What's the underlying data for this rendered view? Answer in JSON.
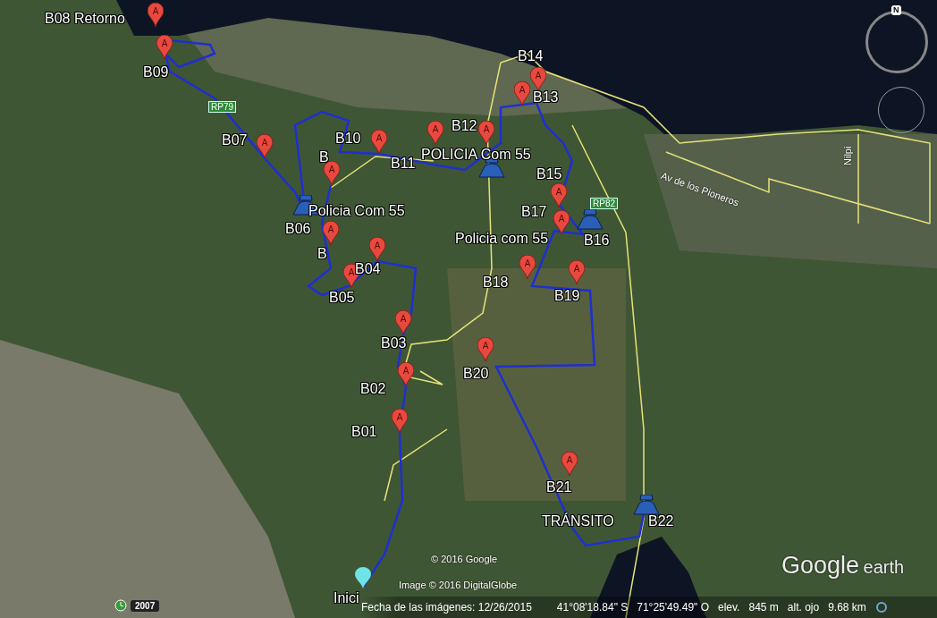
{
  "map": {
    "placemarks": [
      {
        "label": "B08 Retorno",
        "kind": "pin",
        "marker": "A"
      },
      {
        "label": "B09",
        "kind": "pin",
        "marker": "A"
      },
      {
        "label": "B07",
        "kind": "pin",
        "marker": "A"
      },
      {
        "label": "B10",
        "kind": "pin",
        "marker": "A"
      },
      {
        "label": "B11",
        "kind": "pin",
        "marker": "A"
      },
      {
        "label": "B12",
        "kind": "pin",
        "marker": "A"
      },
      {
        "label": "POLICIA Com 55",
        "kind": "police"
      },
      {
        "label": "B14",
        "kind": "pin",
        "marker": "A"
      },
      {
        "label": "B13",
        "kind": "pin",
        "marker": "A"
      },
      {
        "label": "B",
        "kind": "pin",
        "marker": "A"
      },
      {
        "label": "Policia Com 55",
        "kind": "police"
      },
      {
        "label": "B06",
        "kind": "label"
      },
      {
        "label": "B",
        "kind": "pin",
        "marker": "A"
      },
      {
        "label": "B04",
        "kind": "pin",
        "marker": "A"
      },
      {
        "label": "B05",
        "kind": "pin",
        "marker": "A"
      },
      {
        "label": "B03",
        "kind": "pin",
        "marker": "A"
      },
      {
        "label": "B02",
        "kind": "pin",
        "marker": "A"
      },
      {
        "label": "B01",
        "kind": "pin",
        "marker": "A"
      },
      {
        "label": "B15",
        "kind": "pin",
        "marker": "A"
      },
      {
        "label": "B17",
        "kind": "pin",
        "marker": "A"
      },
      {
        "label": "Policia com 55",
        "kind": "police"
      },
      {
        "label": "B16",
        "kind": "label"
      },
      {
        "label": "B18",
        "kind": "pin",
        "marker": "A"
      },
      {
        "label": "B19",
        "kind": "pin",
        "marker": "A"
      },
      {
        "label": "B20",
        "kind": "pin",
        "marker": "A"
      },
      {
        "label": "B21",
        "kind": "pin",
        "marker": "A"
      },
      {
        "label": "TRÁNSITO",
        "kind": "police"
      },
      {
        "label": "B22",
        "kind": "label"
      },
      {
        "label": "Inici",
        "kind": "start"
      }
    ],
    "road_shields": [
      "RP79",
      "RP82"
    ],
    "street_labels": [
      "Av de los Pioneros",
      "Nilpi"
    ],
    "attribution": [
      "© 2016 Google",
      "Image © 2016 DigitalGlobe"
    ]
  },
  "logo": {
    "brand": "Google",
    "product": "earth"
  },
  "navigation": {
    "north": "N"
  },
  "time_slider": {
    "year": "2007"
  },
  "status_bar": {
    "imagery_date": "Fecha de las imágenes: 12/26/2015",
    "latitude": "41°08'18.84\" S",
    "longitude": "71°25'49.49\" O",
    "elevation_label": "elev.",
    "elevation": "845 m",
    "eye_alt_label": "alt. ojo",
    "eye_alt": "9.68 km"
  }
}
